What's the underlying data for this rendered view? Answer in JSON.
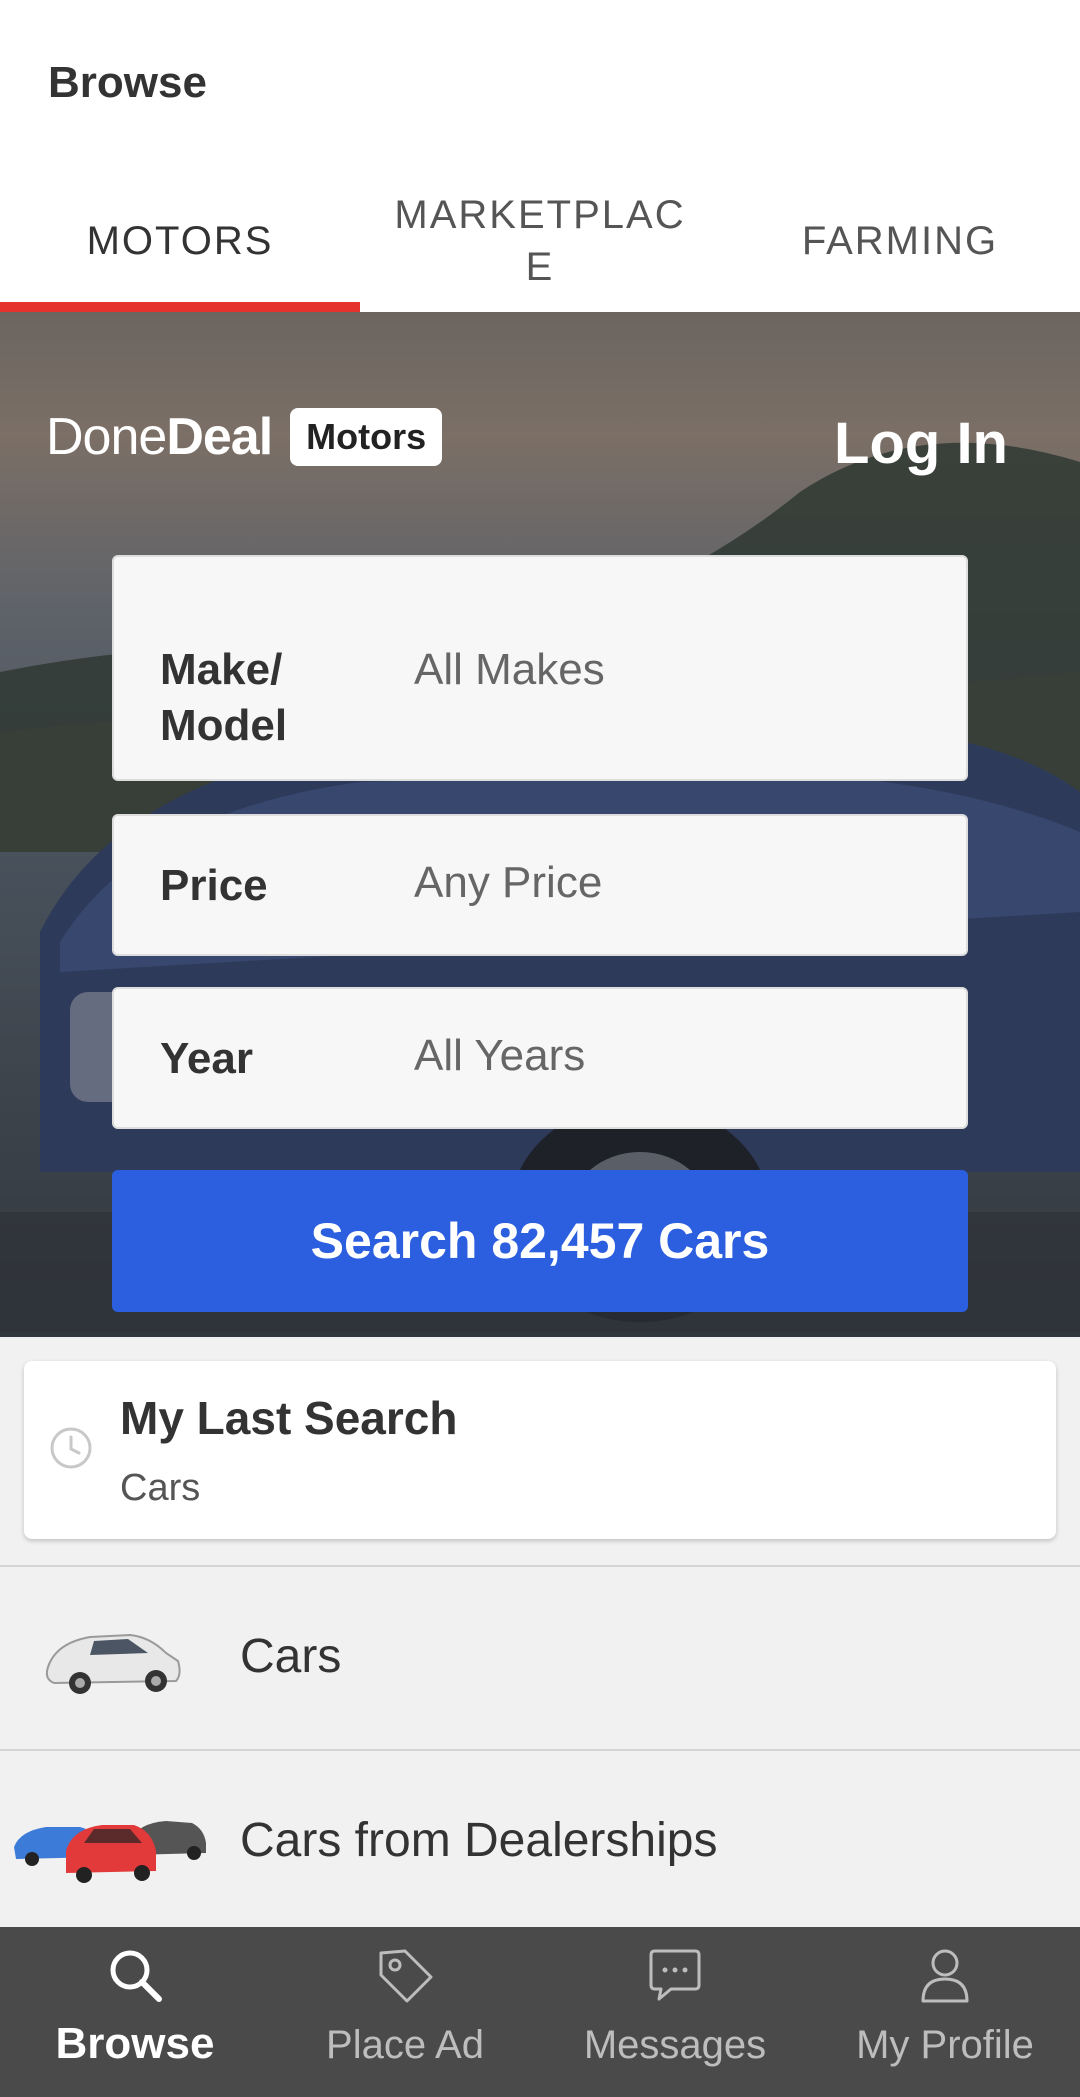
{
  "app": {
    "title": "Browse"
  },
  "tabs": [
    {
      "label": "MOTORS",
      "active": true
    },
    {
      "label": "MARKETPLACE",
      "active": false
    },
    {
      "label": "FARMING",
      "active": false
    }
  ],
  "hero": {
    "logo": {
      "done": "Done",
      "deal": "Deal",
      "badge": "Motors"
    },
    "login_label": "Log In",
    "fields": {
      "make": {
        "label": "Make/ Model",
        "value": "All Makes"
      },
      "price": {
        "label": "Price",
        "value": "Any Price"
      },
      "year": {
        "label": "Year",
        "value": "All Years"
      }
    },
    "search_button": "Search 82,457 Cars"
  },
  "last_search": {
    "title": "My Last Search",
    "subtitle": "Cars",
    "icon": "clock-icon"
  },
  "categories": [
    {
      "label": "Cars",
      "icon": "car-thumbnail"
    },
    {
      "label": "Cars from Dealerships",
      "icon": "dealership-cars-thumbnail"
    }
  ],
  "bottom_nav": [
    {
      "label": "Browse",
      "icon": "search-icon",
      "active": true
    },
    {
      "label": "Place Ad",
      "icon": "tag-icon",
      "active": false
    },
    {
      "label": "Messages",
      "icon": "chat-icon",
      "active": false
    },
    {
      "label": "My Profile",
      "icon": "user-icon",
      "active": false
    }
  ],
  "colors": {
    "accent_red": "#e5322d",
    "primary_blue": "#2c5fe0",
    "nav_bg": "#4a4a4a"
  }
}
